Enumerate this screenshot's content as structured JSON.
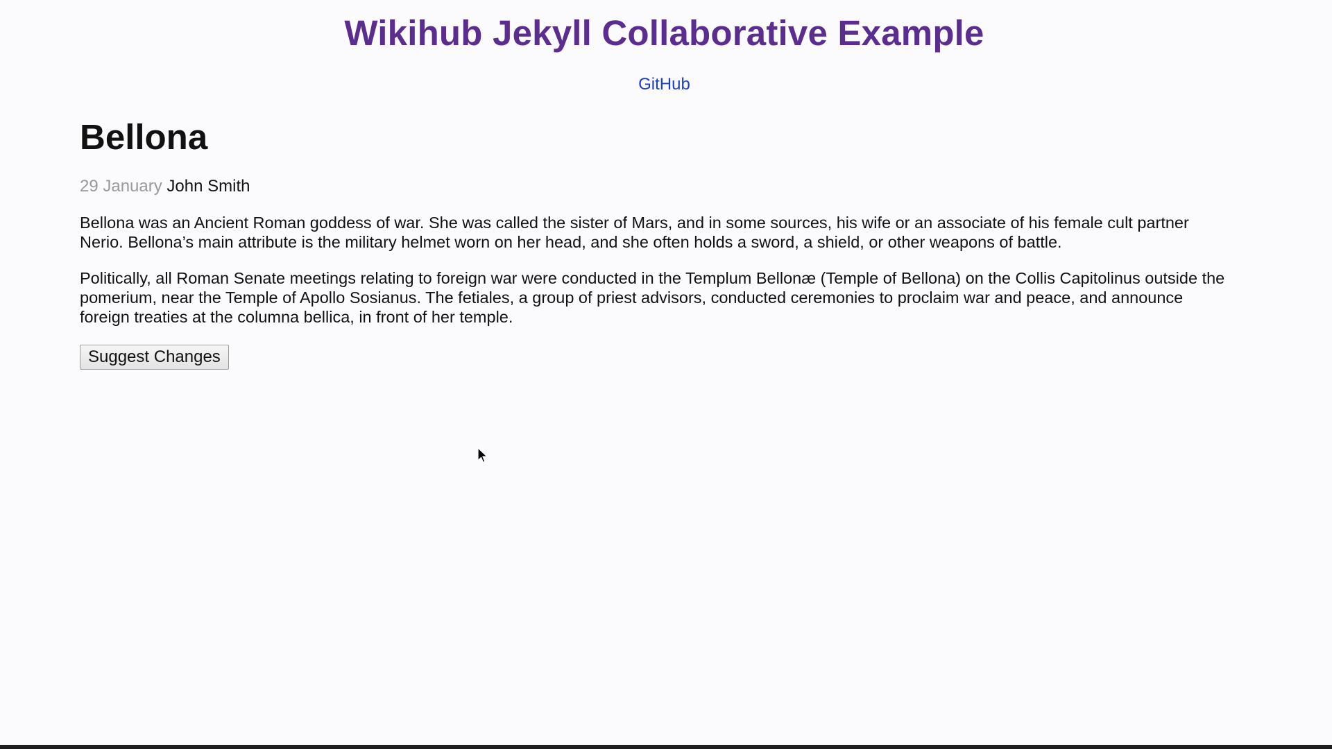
{
  "header": {
    "site_title": "Wikihub Jekyll Collaborative Example",
    "nav_link": "GitHub"
  },
  "post": {
    "title": "Bellona",
    "date": "29 January",
    "author": "John Smith",
    "paragraphs": [
      "Bellona was an Ancient Roman goddess of war. She was called the sister of Mars, and in some sources, his wife or an associate of his female cult partner Nerio. Bellona’s main attribute is the military helmet worn on her head, and she often holds a sword, a shield, or other weapons of battle.",
      "Politically, all Roman Senate meetings relating to foreign war were conducted in the Templum Bellonæ (Temple of Bellona) on the Collis Capitolinus outside the pomerium, near the Temple of Apollo Sosianus. The fetiales, a group of priest advisors, conducted ceremonies to proclaim war and peace, and announce foreign treaties at the columna bellica, in front of her temple."
    ],
    "suggest_button": "Suggest Changes"
  },
  "colors": {
    "title": "#5b2d8e",
    "link": "#1a3fc4",
    "date": "#999999",
    "background": "#fbfbfd"
  },
  "icons": {
    "cursor": "mouse-pointer-icon"
  }
}
